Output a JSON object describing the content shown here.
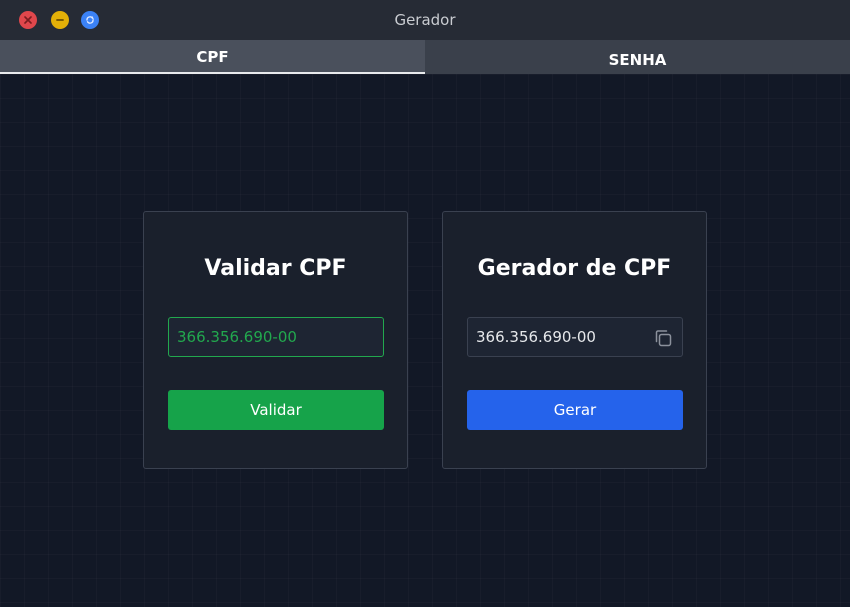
{
  "window": {
    "title": "Gerador",
    "controls": [
      "close-icon",
      "minimize-icon",
      "restore-icon"
    ],
    "control_colors": {
      "close": "#e0474c",
      "minimize": "#e3b008",
      "maximize": "#3b82f6"
    }
  },
  "tabs": [
    {
      "label": "CPF",
      "active": true
    },
    {
      "label": "SENHA",
      "active": false
    }
  ],
  "validate_card": {
    "title": "Validar CPF",
    "input_value": "366.356.690-00",
    "input_state": "valid",
    "button_label": "Validar",
    "button_color": "#16a34a"
  },
  "generate_card": {
    "title": "Gerador de CPF",
    "output_value": "366.356.690-00",
    "copy_icon": "copy-icon",
    "button_label": "Gerar",
    "button_color": "#2563eb"
  }
}
